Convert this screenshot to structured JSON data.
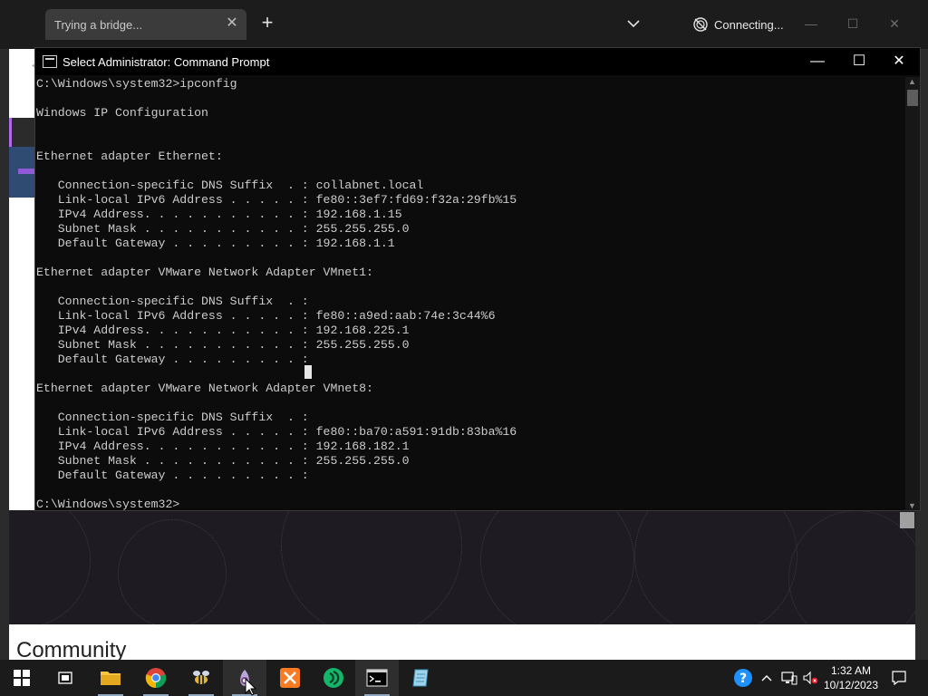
{
  "browser": {
    "tab_title": "Trying a bridge...",
    "tab_close": "✕",
    "new_tab": "+",
    "status": "Connecting...",
    "window_controls": {
      "minimize": "—",
      "maximize": "☐",
      "close": "✕"
    }
  },
  "webpage": {
    "heading": "Community"
  },
  "cmd": {
    "title": "Select Administrator: Command Prompt",
    "controls": {
      "minimize": "—",
      "maximize": "☐",
      "close": "✕"
    },
    "lines": [
      "C:\\Windows\\system32>ipconfig",
      "",
      "Windows IP Configuration",
      "",
      "",
      "Ethernet adapter Ethernet:",
      "",
      "   Connection-specific DNS Suffix  . : collabnet.local",
      "   Link-local IPv6 Address . . . . . : fe80::3ef7:fd69:f32a:29fb%15",
      "   IPv4 Address. . . . . . . . . . . : 192.168.1.15",
      "   Subnet Mask . . . . . . . . . . . : 255.255.255.0",
      "   Default Gateway . . . . . . . . . : 192.168.1.1",
      "",
      "Ethernet adapter VMware Network Adapter VMnet1:",
      "",
      "   Connection-specific DNS Suffix  . :",
      "   Link-local IPv6 Address . . . . . : fe80::a9ed:aab:74e:3c44%6",
      "   IPv4 Address. . . . . . . . . . . : 192.168.225.1",
      "   Subnet Mask . . . . . . . . . . . : 255.255.255.0",
      "   Default Gateway . . . . . . . . . :",
      "",
      "Ethernet adapter VMware Network Adapter VMnet8:",
      "",
      "   Connection-specific DNS Suffix  . :",
      "   Link-local IPv6 Address . . . . . : fe80::ba70:a591:91db:83ba%16",
      "   IPv4 Address. . . . . . . . . . . : 192.168.182.1",
      "   Subnet Mask . . . . . . . . . . . : 255.255.255.0",
      "   Default Gateway . . . . . . . . . :",
      "",
      "C:\\Windows\\system32>"
    ]
  },
  "taskbar": {
    "apps": [
      {
        "name": "start-button",
        "icon": "windows-logo-icon"
      },
      {
        "name": "task-view-button",
        "icon": "task-view-icon"
      },
      {
        "name": "file-explorer-button",
        "icon": "folder-icon"
      },
      {
        "name": "chrome-button",
        "icon": "chrome-icon"
      },
      {
        "name": "app-button",
        "icon": "bee-icon"
      },
      {
        "name": "tor-browser-button",
        "icon": "onion-icon"
      },
      {
        "name": "xampp-button",
        "icon": "xampp-icon"
      },
      {
        "name": "app-green-button",
        "icon": "green-circle-icon"
      },
      {
        "name": "cmd-button",
        "icon": "terminal-icon"
      },
      {
        "name": "app-notes-button",
        "icon": "notepad-icon"
      }
    ],
    "tray": {
      "help": "?",
      "chevron": "^"
    },
    "clock": {
      "time": "1:32 AM",
      "date": "10/12/2023"
    }
  },
  "colors": {
    "console_bg": "#0c0c0c",
    "console_text": "#cccccc",
    "taskbar_bg": "#1b1b1b"
  }
}
